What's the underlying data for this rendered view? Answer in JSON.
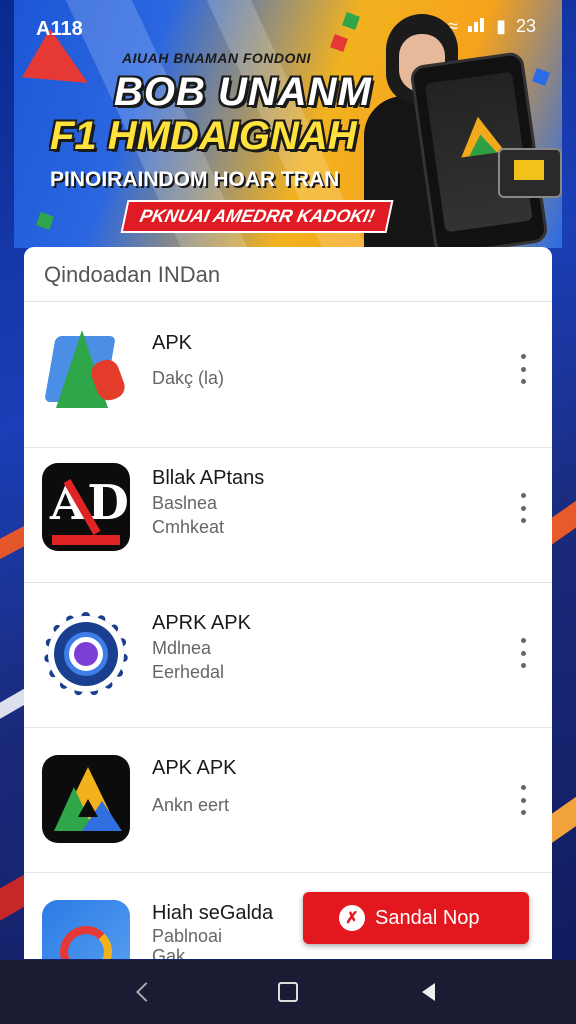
{
  "status_bar": {
    "time": "A118",
    "battery": "23"
  },
  "banner": {
    "small_text": "AIUAH BNAMAN FONDONI",
    "title_line1": "BOB UNANM",
    "title_line2": "F1 HMDAIGNAH",
    "subtitle": "PINOIRAINDOM HOAR TRAN",
    "cta": "PKNUAI AMEDRR KADOKI!"
  },
  "section": {
    "header": "Qindoadan INDan"
  },
  "apps": [
    {
      "name": "APK",
      "line1": "Dakç (la)",
      "line2": "",
      "icon": "apk-arrow-icon"
    },
    {
      "name": "Bllak APtans",
      "line1": "Baslnea",
      "line2": "Cmhkeat",
      "icon": "ad-logo-icon"
    },
    {
      "name": "APRK APK",
      "line1": "Mdlnea",
      "line2": "Eerhedal",
      "icon": "gear-icon"
    },
    {
      "name": "APK APK",
      "line1": "Ankn eert",
      "line2": "",
      "icon": "triangle-logo-icon"
    },
    {
      "name": "Hiah seGalda",
      "line1": "Pablnoai",
      "line2": "Gak",
      "icon": "swirl-logo-icon"
    }
  ],
  "fab": {
    "label": "Sandal Nop",
    "icon": "no-icon"
  },
  "colors": {
    "accent_red": "#e3181e",
    "card_bg": "#ffffff",
    "nav_bg": "#1b1b33"
  }
}
